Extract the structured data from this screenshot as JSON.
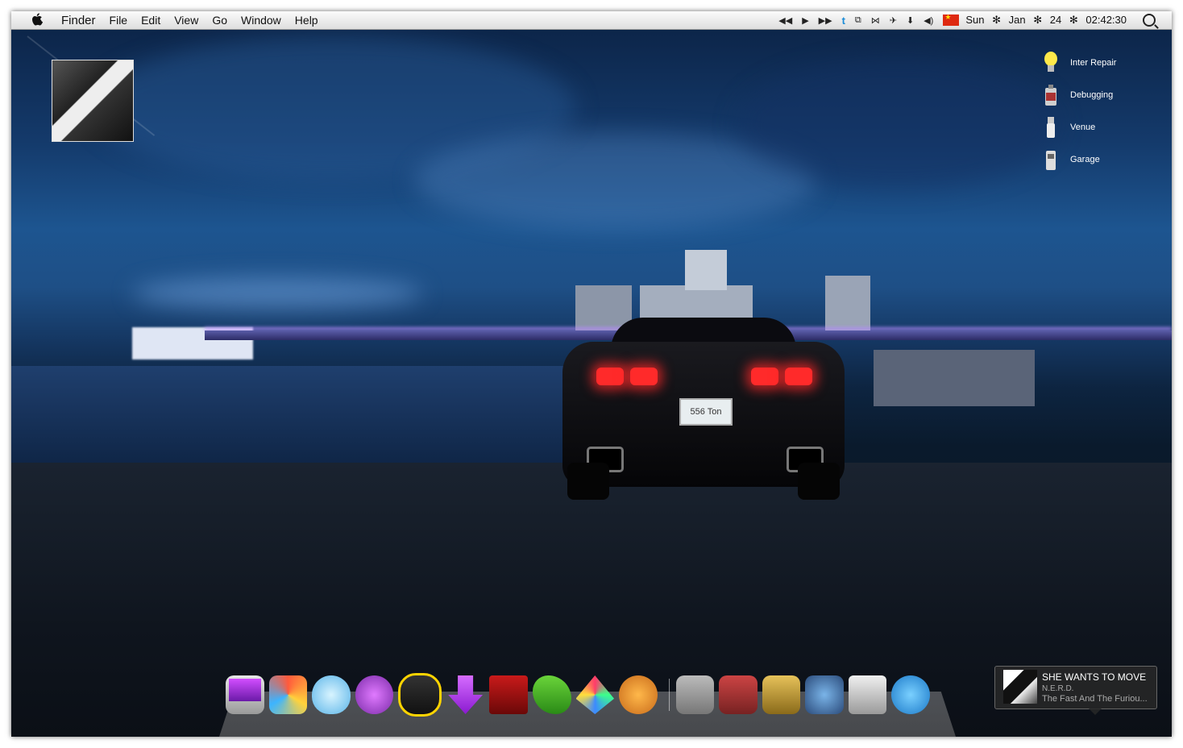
{
  "menubar": {
    "app_name": "Finder",
    "menus": [
      "File",
      "Edit",
      "View",
      "Go",
      "Window",
      "Help"
    ],
    "status_icons": [
      "rewind-icon",
      "play-icon",
      "fast-forward-icon",
      "twitter-icon",
      "network-icon",
      "bluetooth-icon",
      "airplane-icon",
      "download-icon",
      "volume-icon"
    ],
    "flag": "china-flag",
    "clock": {
      "day": "Sun",
      "sep1": "✻",
      "month": "Jan",
      "sep2": "✻",
      "date": "24",
      "sep3": "✻",
      "time": "02:42:30"
    }
  },
  "side_menu": {
    "items": [
      {
        "label": "Inter Repair",
        "icon": "lightbulb-icon"
      },
      {
        "label": "Debugging",
        "icon": "spray-can-icon"
      },
      {
        "label": "Venue",
        "icon": "usb-icon"
      },
      {
        "label": "Garage",
        "icon": "gas-pump-icon"
      }
    ]
  },
  "car": {
    "plate": "556 Ton"
  },
  "dock": {
    "left_apps": [
      "imac-icon",
      "pinwheel-icon",
      "egg-bowtie-icon",
      "itunes-icon",
      "mouse-icon",
      "download-arrow-icon",
      "theater-icon",
      "crocodile-icon",
      "origami-bird-icon",
      "phone-icon"
    ],
    "right_apps": [
      "photos-basket-icon",
      "trophy-basket-icon",
      "pencil-basket-icon",
      "music-basket-icon",
      "trash-icon",
      "bird-icon"
    ]
  },
  "now_playing": {
    "title": "SHE WANTS TO MOVE",
    "artist": "N.E.R.D.",
    "album": "The Fast And The Furiou..."
  }
}
